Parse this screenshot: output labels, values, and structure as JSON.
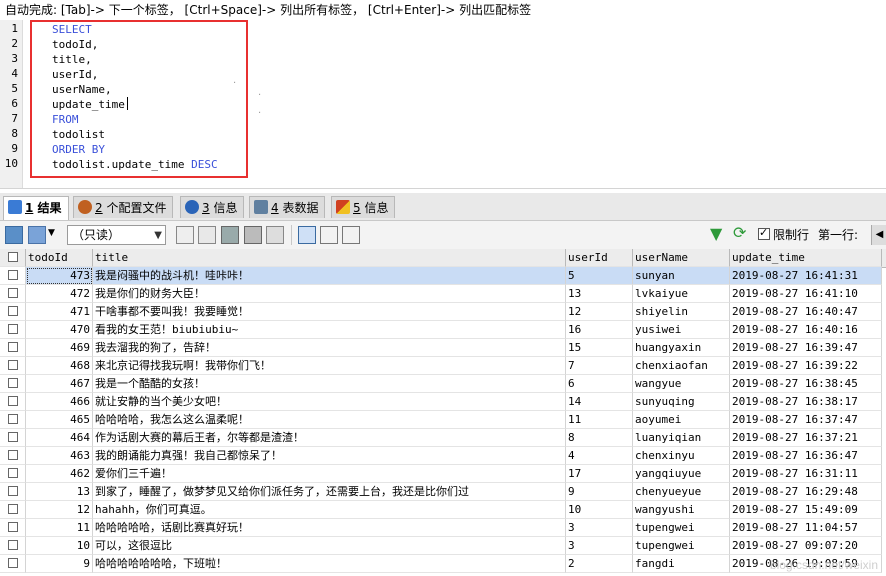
{
  "hint": "自动完成: [Tab]-> 下一个标签， [Ctrl+Space]-> 列出所有标签， [Ctrl+Enter]-> 列出匹配标签",
  "editor": {
    "lines": [
      {
        "num": "1",
        "parts": [
          {
            "t": "SELECT",
            "kw": true
          }
        ]
      },
      {
        "num": "2",
        "parts": [
          {
            "t": "todoId,",
            "kw": false
          }
        ]
      },
      {
        "num": "3",
        "parts": [
          {
            "t": "title,",
            "kw": false
          }
        ]
      },
      {
        "num": "4",
        "parts": [
          {
            "t": "userId,",
            "kw": false
          }
        ]
      },
      {
        "num": "5",
        "parts": [
          {
            "t": "userName,",
            "kw": false
          }
        ]
      },
      {
        "num": "6",
        "parts": [
          {
            "t": "update_time",
            "kw": false
          }
        ]
      },
      {
        "num": "7",
        "parts": [
          {
            "t": "FROM",
            "kw": true
          }
        ]
      },
      {
        "num": "8",
        "parts": [
          {
            "t": "todolist",
            "kw": false
          }
        ]
      },
      {
        "num": "9",
        "parts": [
          {
            "t": "ORDER BY",
            "kw": true
          }
        ]
      },
      {
        "num": "10",
        "parts": [
          {
            "t": "todolist.update_time ",
            "kw": false
          },
          {
            "t": "DESC",
            "kw": true
          }
        ]
      }
    ],
    "keyword_color": "#3a50d9",
    "highlight_color": "#e83030"
  },
  "tabs": [
    {
      "num": "1",
      "label": "结果",
      "icon": "grid-icon",
      "color": "#3a7bd5",
      "active": true
    },
    {
      "num": "2",
      "label": "个配置文件",
      "icon": "profile-icon",
      "color": "#c06020",
      "active": false
    },
    {
      "num": "3",
      "label": "信息",
      "icon": "info-icon",
      "color": "#2a64b8",
      "active": false
    },
    {
      "num": "4",
      "label": "表数据",
      "icon": "table-icon",
      "color": "#6080a0",
      "active": false
    },
    {
      "num": "5",
      "label": "信息",
      "icon": "history-icon",
      "color": "#d04020",
      "active": false
    }
  ],
  "toolbar": {
    "mode": "（只读）",
    "limit_label": "限制行",
    "first_row_label": "第一行:"
  },
  "columns": [
    "todoId",
    "title",
    "userId",
    "userName",
    "update_time"
  ],
  "rows": [
    {
      "todoId": "473",
      "title": "我是闷骚中的战斗机！哇咔咔！",
      "userId": "5",
      "userName": "sunyan",
      "update_time": "2019-08-27 16:41:31"
    },
    {
      "todoId": "472",
      "title": "我是你们的财务大臣！",
      "userId": "13",
      "userName": "lvkaiyue",
      "update_time": "2019-08-27 16:41:10"
    },
    {
      "todoId": "471",
      "title": "干啥事都不要叫我！我要睡觉！",
      "userId": "12",
      "userName": "shiyelin",
      "update_time": "2019-08-27 16:40:47"
    },
    {
      "todoId": "470",
      "title": "看我的女王范！biubiubiu~",
      "userId": "16",
      "userName": "yusiwei",
      "update_time": "2019-08-27 16:40:16"
    },
    {
      "todoId": "469",
      "title": "我去溜我的狗了，告辞！",
      "userId": "15",
      "userName": "huangyaxin",
      "update_time": "2019-08-27 16:39:47"
    },
    {
      "todoId": "468",
      "title": "来北京记得找我玩啊！我带你们飞！",
      "userId": "7",
      "userName": "chenxiaofan",
      "update_time": "2019-08-27 16:39:22"
    },
    {
      "todoId": "467",
      "title": "我是一个酷酷的女孩！",
      "userId": "6",
      "userName": "wangyue",
      "update_time": "2019-08-27 16:38:45"
    },
    {
      "todoId": "466",
      "title": "就让安静的当个美少女吧！",
      "userId": "14",
      "userName": "sunyuqing",
      "update_time": "2019-08-27 16:38:17"
    },
    {
      "todoId": "465",
      "title": "哈哈哈哈，我怎么这么温柔呢！",
      "userId": "11",
      "userName": "aoyumei",
      "update_time": "2019-08-27 16:37:47"
    },
    {
      "todoId": "464",
      "title": "作为话剧大赛的幕后王者，尔等都是渣渣！",
      "userId": "8",
      "userName": "luanyiqian",
      "update_time": "2019-08-27 16:37:21"
    },
    {
      "todoId": "463",
      "title": "我的朗诵能力真强！我自己都惊呆了！",
      "userId": "4",
      "userName": "chenxinyu",
      "update_time": "2019-08-27 16:36:47"
    },
    {
      "todoId": "462",
      "title": "爱你们三千遍！",
      "userId": "17",
      "userName": "yangqiuyue",
      "update_time": "2019-08-27 16:31:11"
    },
    {
      "todoId": "13",
      "title": "到家了，睡醒了，做梦梦见又给你们派任务了，还需要上台，我还是比你们过",
      "userId": "9",
      "userName": "chenyueyue",
      "update_time": "2019-08-27 16:29:48"
    },
    {
      "todoId": "12",
      "title": "hahahh，你们可真逗。",
      "userId": "10",
      "userName": "wangyushi",
      "update_time": "2019-08-27 15:49:09"
    },
    {
      "todoId": "11",
      "title": "哈哈哈哈哈，话剧比赛真好玩！",
      "userId": "3",
      "userName": "tupengwei",
      "update_time": "2019-08-27 11:04:57"
    },
    {
      "todoId": "10",
      "title": "可以，这很逗比",
      "userId": "3",
      "userName": "tupengwei",
      "update_time": "2019-08-27 09:07:20"
    },
    {
      "todoId": "9",
      "title": "哈哈哈哈哈哈哈，下班啦！",
      "userId": "2",
      "userName": "fangdi",
      "update_time": "2019-08-26 19:08:59"
    }
  ],
  "watermark": "blog.csdn.net/weixin",
  "selected_row_color": "#c9dcf5"
}
